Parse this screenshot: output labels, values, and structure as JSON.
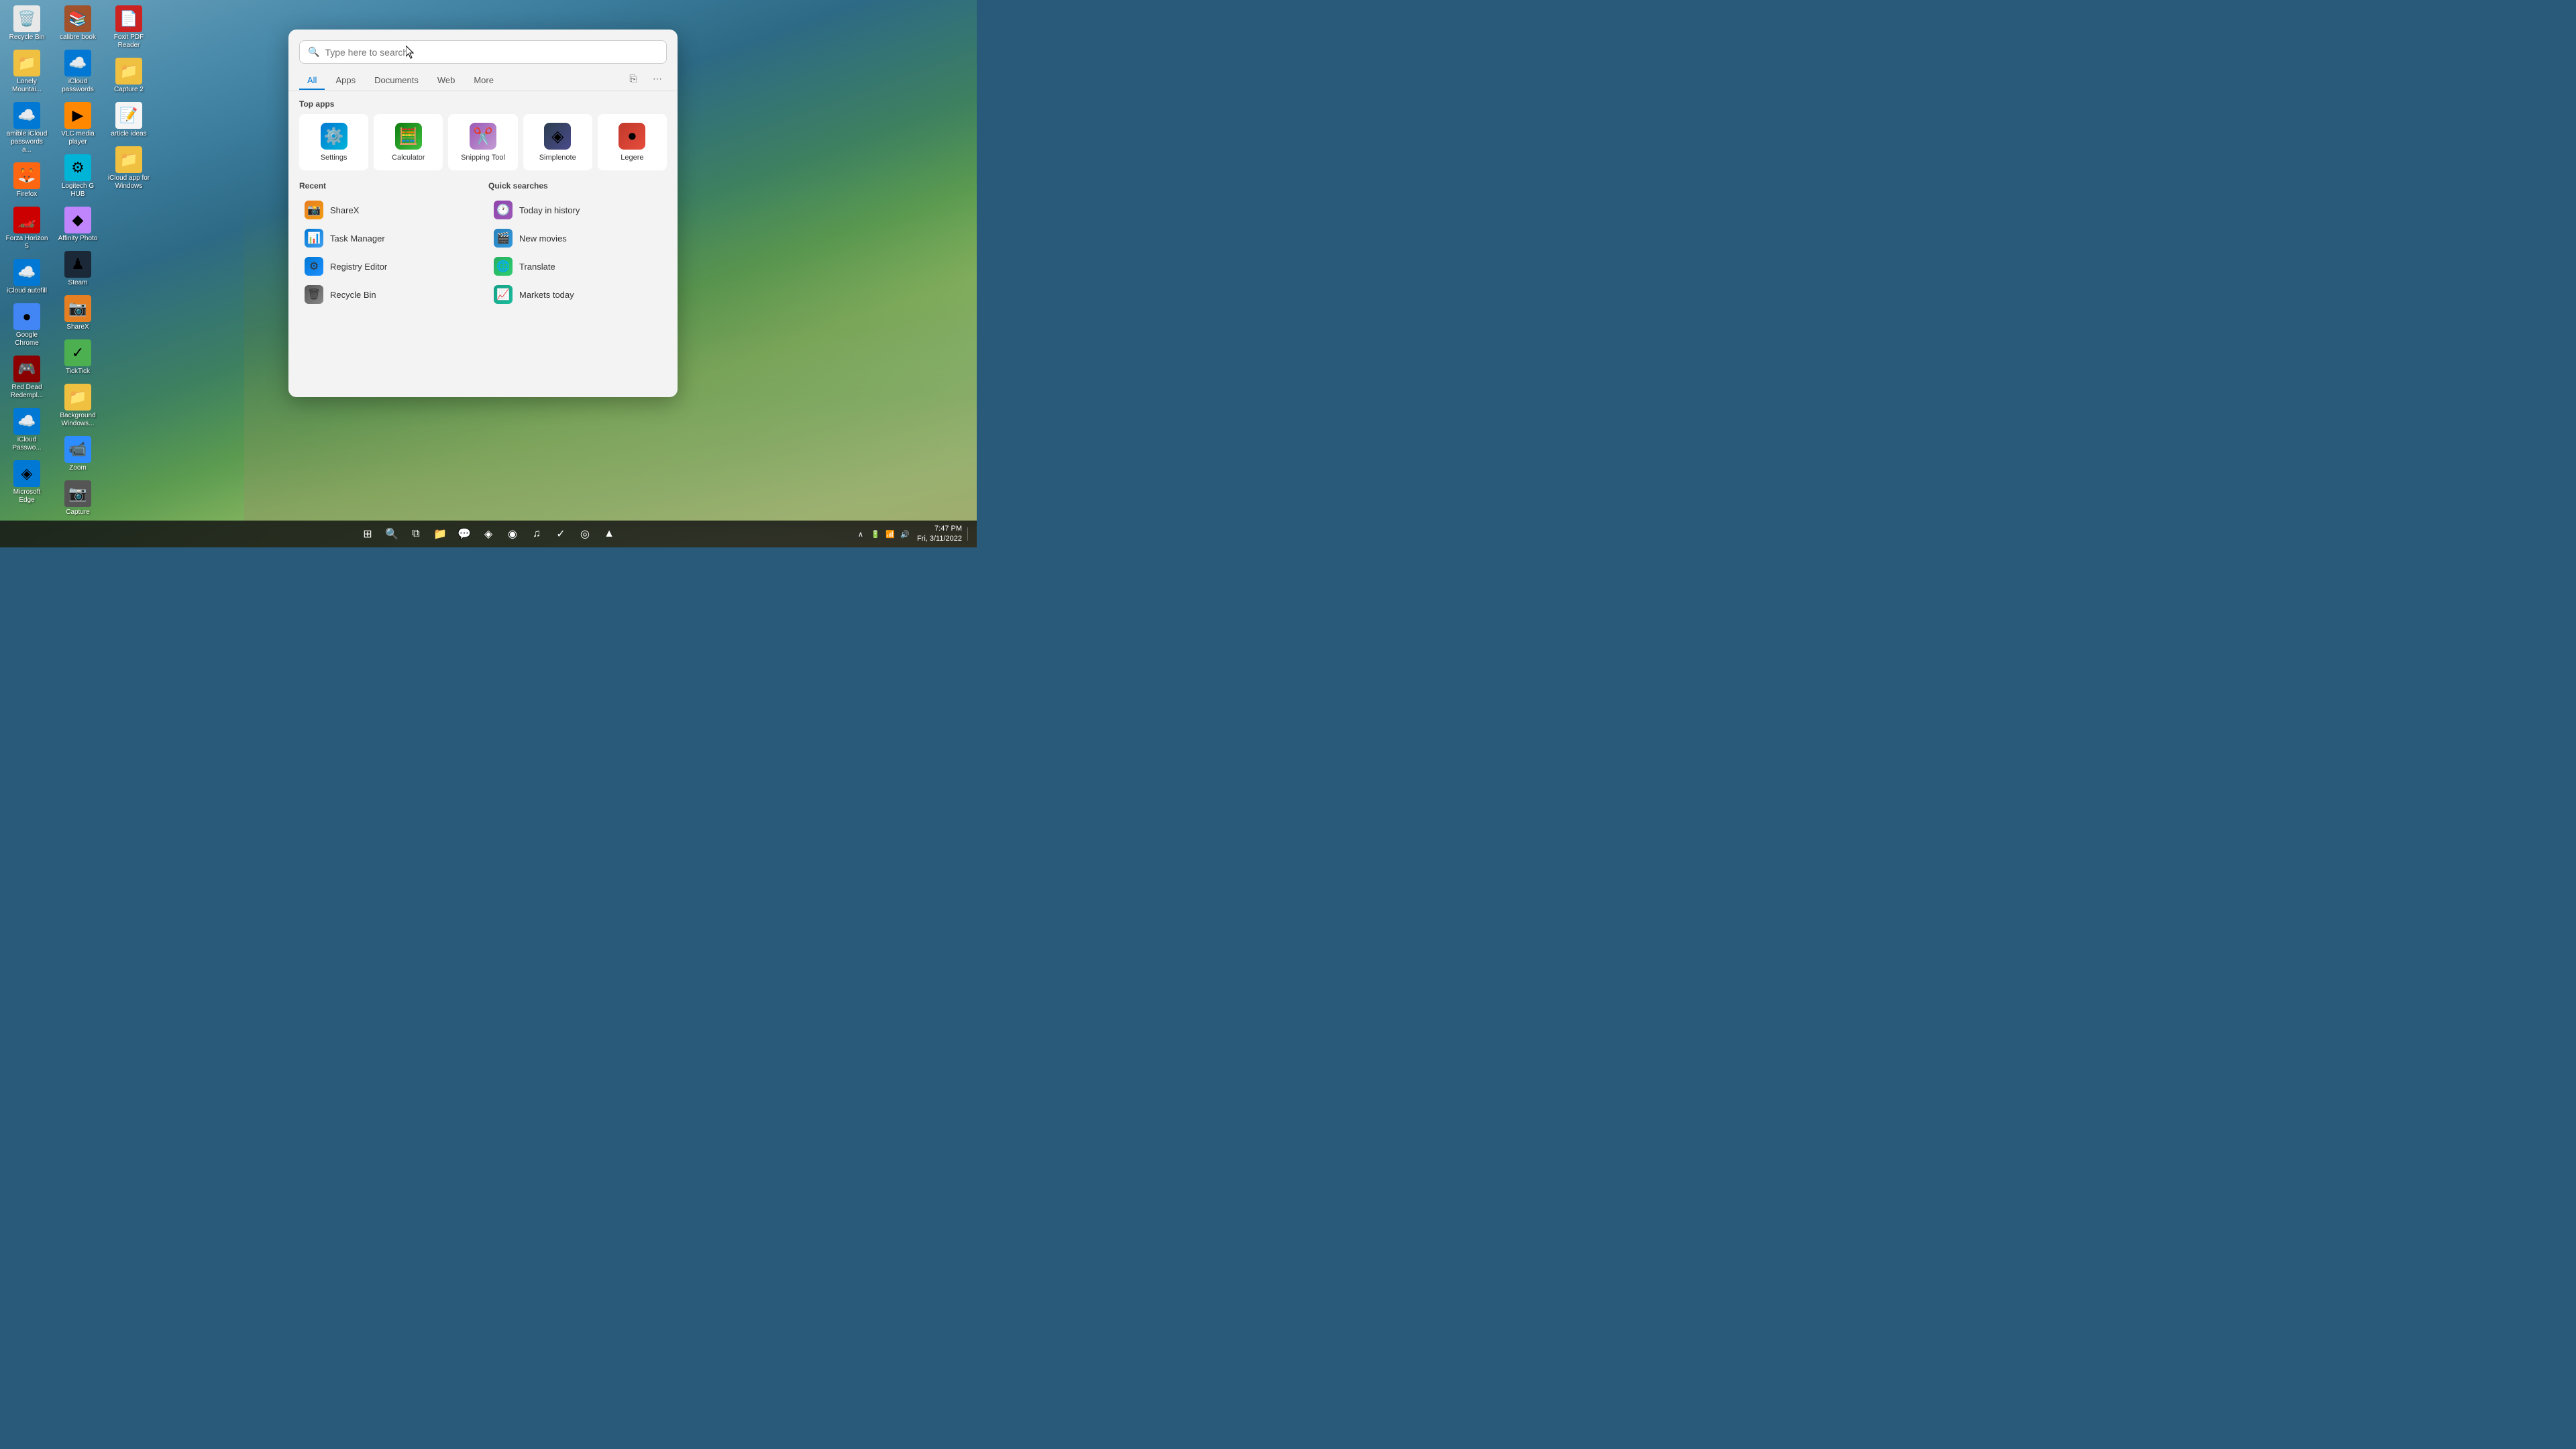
{
  "desktop": {
    "icons": [
      {
        "id": "recycle-bin",
        "label": "Recycle Bin",
        "emoji": "🗑️",
        "color": "#e8e8e8"
      },
      {
        "id": "lonely-mountain",
        "label": "Lonely Mountai...",
        "emoji": "📁",
        "color": "#f0c040"
      },
      {
        "id": "icloud-passwords",
        "label": "amible iCloud passwords a...",
        "emoji": "☁️",
        "color": "#0078d4"
      },
      {
        "id": "firefox",
        "label": "Firefox",
        "emoji": "🦊",
        "color": "#ff6611"
      },
      {
        "id": "forza-horizon",
        "label": "Forza Horizon 5",
        "emoji": "🏎️",
        "color": "#c00"
      },
      {
        "id": "icloud-autofill",
        "label": "iCloud autofill",
        "emoji": "☁️",
        "color": "#0078d4"
      },
      {
        "id": "google-chrome",
        "label": "Google Chrome",
        "emoji": "●",
        "color": "#4285f4"
      },
      {
        "id": "red-dead",
        "label": "Red Dead Redempl...",
        "emoji": "🎮",
        "color": "#8b0000"
      },
      {
        "id": "icloud-password",
        "label": "iCloud Passwo...",
        "emoji": "☁️",
        "color": "#0078d4"
      },
      {
        "id": "ms-edge",
        "label": "Microsoft Edge",
        "emoji": "◈",
        "color": "#0078d4"
      },
      {
        "id": "calibre",
        "label": "calibre book",
        "emoji": "📚",
        "color": "#a0522d"
      },
      {
        "id": "icloud-passwords2",
        "label": "iCloud passwords",
        "emoji": "☁️",
        "color": "#0078d4"
      },
      {
        "id": "vlc",
        "label": "VLC media player",
        "emoji": "▶",
        "color": "#ff8800"
      },
      {
        "id": "logitech",
        "label": "Logitech G HUB",
        "emoji": "⚙",
        "color": "#00b4d8"
      },
      {
        "id": "affinity",
        "label": "Affinity Photo",
        "emoji": "◆",
        "color": "#c084fc"
      },
      {
        "id": "steam",
        "label": "Steam",
        "emoji": "♟",
        "color": "#1b2838"
      },
      {
        "id": "sharex",
        "label": "ShareX",
        "emoji": "📷",
        "color": "#e67e22"
      },
      {
        "id": "ticktick",
        "label": "TickTick",
        "emoji": "✓",
        "color": "#4caf50"
      },
      {
        "id": "bg-windows",
        "label": "Background Windows...",
        "emoji": "📁",
        "color": "#f0c040"
      },
      {
        "id": "zoom",
        "label": "Zoom",
        "emoji": "📹",
        "color": "#2d8cff"
      },
      {
        "id": "capture",
        "label": "Capture",
        "emoji": "📷",
        "color": "#555"
      },
      {
        "id": "foxit",
        "label": "Foxit PDF Reader",
        "emoji": "📄",
        "color": "#cc2222"
      },
      {
        "id": "capture2",
        "label": "Capture 2",
        "emoji": "📁",
        "color": "#f0c040"
      },
      {
        "id": "article-ideas",
        "label": "article ideas",
        "emoji": "📝",
        "color": "#f5f5f5"
      },
      {
        "id": "icloud-app",
        "label": "iCloud app for Windows",
        "emoji": "📁",
        "color": "#f0c040"
      }
    ]
  },
  "taskbar": {
    "icons": [
      {
        "id": "start",
        "label": "Start",
        "symbol": "⊞"
      },
      {
        "id": "search",
        "label": "Search",
        "symbol": "🔍"
      },
      {
        "id": "task-view",
        "label": "Task View",
        "symbol": "⧉"
      },
      {
        "id": "file-explorer",
        "label": "File Explorer",
        "symbol": "📁"
      },
      {
        "id": "whatsapp",
        "label": "WhatsApp",
        "symbol": "💬"
      },
      {
        "id": "edge",
        "label": "Microsoft Edge",
        "symbol": "◈"
      },
      {
        "id": "epic",
        "label": "Epic Games",
        "symbol": "◉"
      },
      {
        "id": "spotify",
        "label": "Spotify",
        "symbol": "♫"
      },
      {
        "id": "ticktick-bar",
        "label": "TickTick",
        "symbol": "✓"
      },
      {
        "id": "snagit",
        "label": "Snagit",
        "symbol": "◎"
      },
      {
        "id": "brave",
        "label": "Brave",
        "symbol": "▲"
      }
    ],
    "clock": {
      "time": "7:47 PM",
      "date": "Fri, 3/11/2022"
    }
  },
  "search": {
    "placeholder": "Type here to search",
    "tabs": [
      "All",
      "Apps",
      "Documents",
      "Web",
      "More"
    ],
    "active_tab": "All",
    "top_apps": {
      "title": "Top apps",
      "apps": [
        {
          "id": "settings",
          "label": "Settings",
          "emoji": "⚙️",
          "color_class": "ic-settings"
        },
        {
          "id": "calculator",
          "label": "Calculator",
          "emoji": "🧮",
          "color_class": "ic-calc"
        },
        {
          "id": "snipping",
          "label": "Snipping Tool",
          "emoji": "✂️",
          "color_class": "ic-snip"
        },
        {
          "id": "simplenote",
          "label": "Simplenote",
          "emoji": "◈",
          "color_class": "ic-simple"
        },
        {
          "id": "legere",
          "label": "Legere",
          "emoji": "●",
          "color_class": "ic-legere"
        }
      ]
    },
    "recent": {
      "title": "Recent",
      "items": [
        {
          "id": "sharex",
          "label": "ShareX",
          "emoji": "📸",
          "color_class": "ic-sharex"
        },
        {
          "id": "task-manager",
          "label": "Task Manager",
          "emoji": "📊",
          "color_class": "ic-task"
        },
        {
          "id": "registry-editor",
          "label": "Registry Editor",
          "emoji": "⚙",
          "color_class": "ic-registry"
        },
        {
          "id": "recycle-bin",
          "label": "Recycle Bin",
          "emoji": "🗑",
          "color_class": "ic-recycle"
        }
      ]
    },
    "quick_searches": {
      "title": "Quick searches",
      "items": [
        {
          "id": "today-history",
          "label": "Today in history",
          "emoji": "🕐",
          "color_class": "ic-history"
        },
        {
          "id": "new-movies",
          "label": "New movies",
          "emoji": "🎬",
          "color_class": "ic-movies"
        },
        {
          "id": "translate",
          "label": "Translate",
          "emoji": "🌐",
          "color_class": "ic-translate"
        },
        {
          "id": "markets-today",
          "label": "Markets today",
          "emoji": "📈",
          "color_class": "ic-markets"
        }
      ]
    }
  }
}
